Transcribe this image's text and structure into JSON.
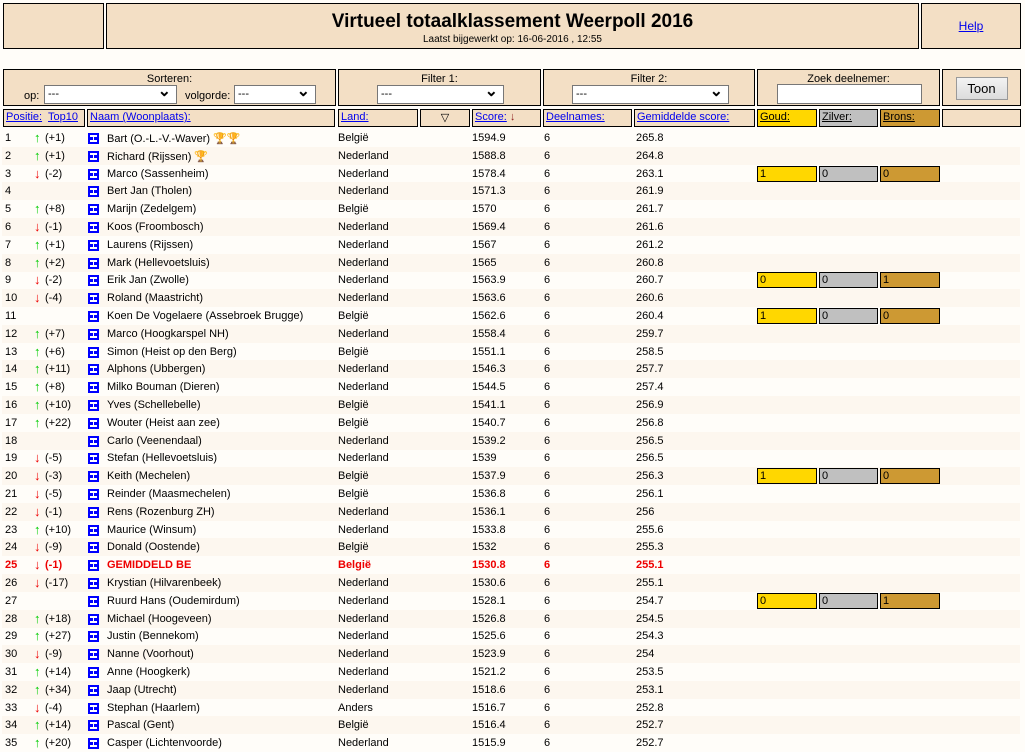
{
  "header": {
    "title": "Virtueel totaalklassement Weerpoll 2016",
    "updated": "Laatst bijgewerkt op: 16-06-2016 , 12:55",
    "help": "Help"
  },
  "controls": {
    "sort_label": "Sorteren:",
    "op_label": "op:",
    "op_value": "---",
    "order_label": "volgorde:",
    "order_value": "---",
    "filter1_label": "Filter 1:",
    "filter1_value": "---",
    "filter2_label": "Filter 2:",
    "filter2_value": "---",
    "search_label": "Zoek deelnemer:",
    "search_value": "",
    "show_button": "Toon"
  },
  "columns": {
    "position": "Positie:",
    "top10": "Top10",
    "name": "Naam (Woonplaats):",
    "country": "Land:",
    "score": "Score:",
    "entries": "Deelnames:",
    "avg": "Gemiddelde score:",
    "gold": "Goud:",
    "silver": "Zilver:",
    "bronze": "Brons:"
  },
  "colors": {
    "gold": "#ffd700",
    "silver": "#c0c0c0",
    "bronze": "#cd9933",
    "panel": "#f3dfc5"
  },
  "rows": [
    {
      "pos": "1",
      "chg": "(+1)",
      "dir": "up",
      "name": "Bart (O.-L.-V.-Waver)",
      "trophies": 2,
      "land": "België",
      "score": "1594.9",
      "n": "6",
      "avg": "265.8"
    },
    {
      "pos": "2",
      "chg": "(+1)",
      "dir": "up",
      "name": "Richard (Rijssen)",
      "trophies": 1,
      "land": "Nederland",
      "score": "1588.8",
      "n": "6",
      "avg": "264.8"
    },
    {
      "pos": "3",
      "chg": "(-2)",
      "dir": "down",
      "name": "Marco (Sassenheim)",
      "land": "Nederland",
      "score": "1578.4",
      "n": "6",
      "avg": "263.1",
      "medals": [
        "1",
        "0",
        "0"
      ]
    },
    {
      "pos": "4",
      "chg": "",
      "dir": "",
      "name": "Bert Jan (Tholen)",
      "land": "Nederland",
      "score": "1571.3",
      "n": "6",
      "avg": "261.9"
    },
    {
      "pos": "5",
      "chg": "(+8)",
      "dir": "up",
      "name": "Marijn (Zedelgem)",
      "land": "België",
      "score": "1570",
      "n": "6",
      "avg": "261.7"
    },
    {
      "pos": "6",
      "chg": "(-1)",
      "dir": "down",
      "name": "Koos (Froombosch)",
      "land": "Nederland",
      "score": "1569.4",
      "n": "6",
      "avg": "261.6"
    },
    {
      "pos": "7",
      "chg": "(+1)",
      "dir": "up",
      "name": "Laurens (Rijssen)",
      "land": "Nederland",
      "score": "1567",
      "n": "6",
      "avg": "261.2"
    },
    {
      "pos": "8",
      "chg": "(+2)",
      "dir": "up",
      "name": "Mark (Hellevoetsluis)",
      "land": "Nederland",
      "score": "1565",
      "n": "6",
      "avg": "260.8"
    },
    {
      "pos": "9",
      "chg": "(-2)",
      "dir": "down",
      "name": "Erik Jan (Zwolle)",
      "land": "Nederland",
      "score": "1563.9",
      "n": "6",
      "avg": "260.7",
      "medals": [
        "0",
        "0",
        "1"
      ]
    },
    {
      "pos": "10",
      "chg": "(-4)",
      "dir": "down",
      "name": "Roland (Maastricht)",
      "land": "Nederland",
      "score": "1563.6",
      "n": "6",
      "avg": "260.6"
    },
    {
      "pos": "11",
      "chg": "",
      "dir": "",
      "name": "Koen De Vogelaere (Assebroek Brugge)",
      "land": "België",
      "score": "1562.6",
      "n": "6",
      "avg": "260.4",
      "medals": [
        "1",
        "0",
        "0"
      ]
    },
    {
      "pos": "12",
      "chg": "(+7)",
      "dir": "up",
      "name": "Marco (Hoogkarspel NH)",
      "land": "Nederland",
      "score": "1558.4",
      "n": "6",
      "avg": "259.7"
    },
    {
      "pos": "13",
      "chg": "(+6)",
      "dir": "up",
      "name": "Simon (Heist op den Berg)",
      "land": "België",
      "score": "1551.1",
      "n": "6",
      "avg": "258.5"
    },
    {
      "pos": "14",
      "chg": "(+11)",
      "dir": "up",
      "name": "Alphons (Ubbergen)",
      "land": "Nederland",
      "score": "1546.3",
      "n": "6",
      "avg": "257.7"
    },
    {
      "pos": "15",
      "chg": "(+8)",
      "dir": "up",
      "name": "Milko Bouman (Dieren)",
      "land": "Nederland",
      "score": "1544.5",
      "n": "6",
      "avg": "257.4"
    },
    {
      "pos": "16",
      "chg": "(+10)",
      "dir": "up",
      "name": "Yves (Schellebelle)",
      "land": "België",
      "score": "1541.1",
      "n": "6",
      "avg": "256.9"
    },
    {
      "pos": "17",
      "chg": "(+22)",
      "dir": "up",
      "name": "Wouter (Heist aan zee)",
      "land": "België",
      "score": "1540.7",
      "n": "6",
      "avg": "256.8"
    },
    {
      "pos": "18",
      "chg": "",
      "dir": "",
      "name": "Carlo (Veenendaal)",
      "land": "Nederland",
      "score": "1539.2",
      "n": "6",
      "avg": "256.5"
    },
    {
      "pos": "19",
      "chg": "(-5)",
      "dir": "down",
      "name": "Stefan (Hellevoetsluis)",
      "land": "Nederland",
      "score": "1539",
      "n": "6",
      "avg": "256.5"
    },
    {
      "pos": "20",
      "chg": "(-3)",
      "dir": "down",
      "name": "Keith (Mechelen)",
      "land": "België",
      "score": "1537.9",
      "n": "6",
      "avg": "256.3",
      "medals": [
        "1",
        "0",
        "0"
      ]
    },
    {
      "pos": "21",
      "chg": "(-5)",
      "dir": "down",
      "name": "Reinder (Maasmechelen)",
      "land": "België",
      "score": "1536.8",
      "n": "6",
      "avg": "256.1"
    },
    {
      "pos": "22",
      "chg": "(-1)",
      "dir": "down",
      "name": "Rens (Rozenburg ZH)",
      "land": "Nederland",
      "score": "1536.1",
      "n": "6",
      "avg": "256"
    },
    {
      "pos": "23",
      "chg": "(+10)",
      "dir": "up",
      "name": "Maurice (Winsum)",
      "land": "Nederland",
      "score": "1533.8",
      "n": "6",
      "avg": "255.6"
    },
    {
      "pos": "24",
      "chg": "(-9)",
      "dir": "down",
      "name": "Donald (Oostende)",
      "land": "België",
      "score": "1532",
      "n": "6",
      "avg": "255.3"
    },
    {
      "pos": "25",
      "chg": "(-1)",
      "dir": "down",
      "name": "GEMIDDELD BE",
      "land": "België",
      "score": "1530.8",
      "n": "6",
      "avg": "255.1",
      "highlight": true
    },
    {
      "pos": "26",
      "chg": "(-17)",
      "dir": "down",
      "name": "Krystian (Hilvarenbeek)",
      "land": "Nederland",
      "score": "1530.6",
      "n": "6",
      "avg": "255.1"
    },
    {
      "pos": "27",
      "chg": "",
      "dir": "",
      "name": "Ruurd Hans (Oudemirdum)",
      "land": "Nederland",
      "score": "1528.1",
      "n": "6",
      "avg": "254.7",
      "medals": [
        "0",
        "0",
        "1"
      ]
    },
    {
      "pos": "28",
      "chg": "(+18)",
      "dir": "up",
      "name": "Michael (Hoogeveen)",
      "land": "Nederland",
      "score": "1526.8",
      "n": "6",
      "avg": "254.5"
    },
    {
      "pos": "29",
      "chg": "(+27)",
      "dir": "up",
      "name": "Justin (Bennekom)",
      "land": "Nederland",
      "score": "1525.6",
      "n": "6",
      "avg": "254.3"
    },
    {
      "pos": "30",
      "chg": "(-9)",
      "dir": "down",
      "name": "Nanne (Voorhout)",
      "land": "Nederland",
      "score": "1523.9",
      "n": "6",
      "avg": "254"
    },
    {
      "pos": "31",
      "chg": "(+14)",
      "dir": "up",
      "name": "Anne (Hoogkerk)",
      "land": "Nederland",
      "score": "1521.2",
      "n": "6",
      "avg": "253.5"
    },
    {
      "pos": "32",
      "chg": "(+34)",
      "dir": "up",
      "name": "Jaap (Utrecht)",
      "land": "Nederland",
      "score": "1518.6",
      "n": "6",
      "avg": "253.1"
    },
    {
      "pos": "33",
      "chg": "(-4)",
      "dir": "down",
      "name": "Stephan (Haarlem)",
      "land": "Anders",
      "score": "1516.7",
      "n": "6",
      "avg": "252.8"
    },
    {
      "pos": "34",
      "chg": "(+14)",
      "dir": "up",
      "name": "Pascal (Gent)",
      "land": "België",
      "score": "1516.4",
      "n": "6",
      "avg": "252.7"
    },
    {
      "pos": "35",
      "chg": "(+20)",
      "dir": "up",
      "name": "Casper (Lichtenvoorde)",
      "land": "Nederland",
      "score": "1515.9",
      "n": "6",
      "avg": "252.7"
    }
  ]
}
